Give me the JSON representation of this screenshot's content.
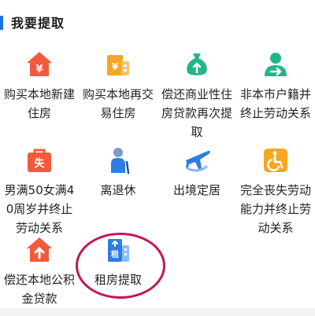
{
  "section": {
    "title": "我要提取"
  },
  "items": [
    {
      "label": "购买本地新建住房",
      "icon": "house-yuan-icon",
      "color": "#f15a3c"
    },
    {
      "label": "购买本地再交易住房",
      "icon": "building-yuan-icon",
      "color": "#f5a623"
    },
    {
      "label": "偿还商业性住房贷款再次提取",
      "icon": "money-bag-icon",
      "color": "#22b48a"
    },
    {
      "label": "非本市户籍并终止劳动关系",
      "icon": "person-arrow-icon",
      "color": "#22b48a"
    },
    {
      "label": "男满50女满40周岁并终止劳动关系",
      "icon": "briefcase-icon",
      "color": "#f15a3c"
    },
    {
      "label": "离退休",
      "icon": "elderly-person-icon",
      "color": "#2e7ce6"
    },
    {
      "label": "出境定居",
      "icon": "airplane-icon",
      "color": "#2e7ce6"
    },
    {
      "label": "完全丧失劳动能力并终止劳动关系",
      "icon": "wheelchair-icon",
      "color": "#f5a623"
    },
    {
      "label": "偿还本地公积金贷款",
      "icon": "house-up-arrow-icon",
      "color": "#f15a3c"
    },
    {
      "label": "租房提取",
      "icon": "rent-building-icon",
      "color": "#2e7ce6",
      "highlight": "circled"
    }
  ]
}
